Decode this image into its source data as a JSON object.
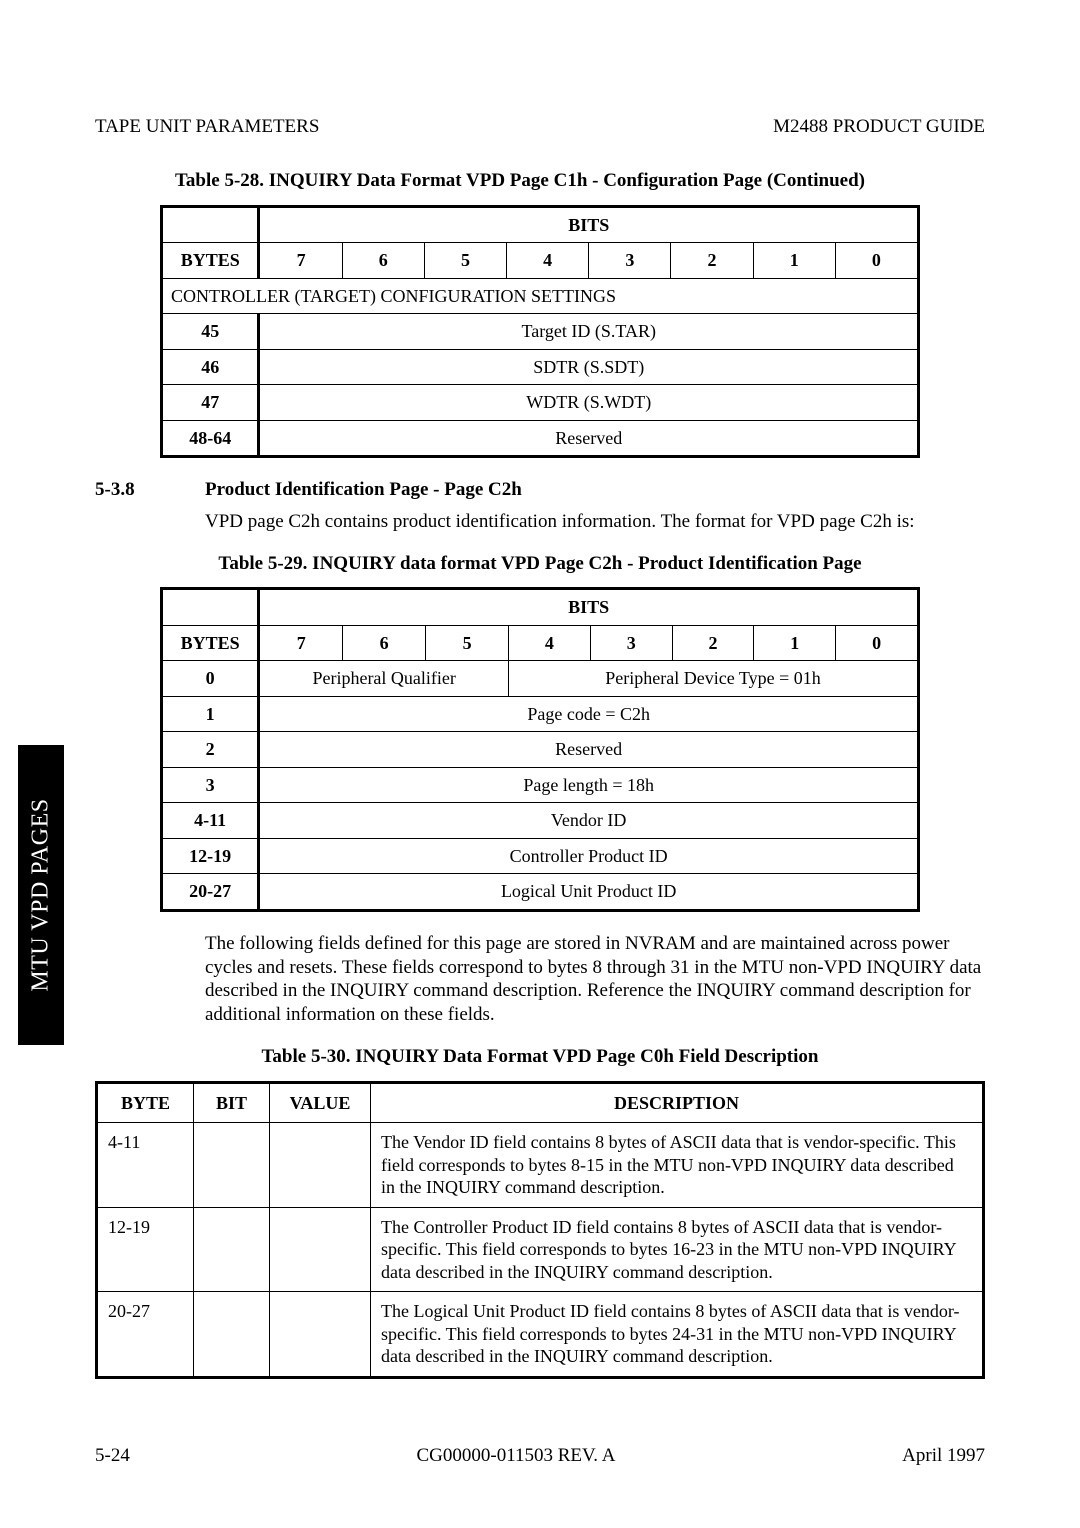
{
  "header": {
    "left": "TAPE UNIT PARAMETERS",
    "right": "M2488 PRODUCT GUIDE"
  },
  "side_tab": "MTU VPD PAGES",
  "table28": {
    "caption": "Table 5-28.   INQUIRY Data Format VPD Page C1h - Configuration Page  (Continued)",
    "bits_label": "BITS",
    "bytes_label": "BYTES",
    "bits": [
      "7",
      "6",
      "5",
      "4",
      "3",
      "2",
      "1",
      "0"
    ],
    "section": "CONTROLLER (TARGET) CONFIGURATION SETTINGS",
    "rows": [
      {
        "byte": "45",
        "desc": "Target ID (S.TAR)"
      },
      {
        "byte": "46",
        "desc": "SDTR (S.SDT)"
      },
      {
        "byte": "47",
        "desc": "WDTR (S.WDT)"
      },
      {
        "byte": "48-64",
        "desc": "Reserved"
      }
    ]
  },
  "section538": {
    "num": "5-3.8",
    "title": "Product Identification Page - Page C2h",
    "para": "VPD page C2h contains product identification information. The format for VPD page C2h is:"
  },
  "table29": {
    "caption": "Table 5-29.   INQUIRY data format VPD Page C2h - Product Identification Page",
    "bits_label": "BITS",
    "bytes_label": "BYTES",
    "bits": [
      "7",
      "6",
      "5",
      "4",
      "3",
      "2",
      "1",
      "0"
    ],
    "row0": {
      "byte": "0",
      "left": "Peripheral Qualifier",
      "right": "Peripheral Device Type = 01h"
    },
    "rows": [
      {
        "byte": "1",
        "desc": "Page code  = C2h"
      },
      {
        "byte": "2",
        "desc": "Reserved"
      },
      {
        "byte": "3",
        "desc": "Page length  = 18h"
      },
      {
        "byte": "4-11",
        "desc": "Vendor ID"
      },
      {
        "byte": "12-19",
        "desc": "Controller Product ID"
      },
      {
        "byte": "20-27",
        "desc": "Logical Unit Product ID"
      }
    ]
  },
  "para_after_t29": "The following fields defined for this page are stored in NVRAM and are maintained across power cycles and resets. These fields correspond to bytes 8 through 31 in the MTU non-VPD INQUIRY data described in the INQUIRY command description. Reference the INQUIRY command description for additional information on these fields.",
  "table30": {
    "caption": "Table 5-30.   INQUIRY Data Format VPD Page C0h Field Description",
    "headers": {
      "byte": "BYTE",
      "bit": "BIT",
      "value": "VALUE",
      "desc": "DESCRIPTION"
    },
    "rows": [
      {
        "byte": "4-11",
        "bit": "",
        "value": "",
        "desc": "The Vendor ID field contains 8 bytes of ASCII data that is vendor-specific.  This field corresponds to bytes 8-15 in the MTU non-VPD INQUIRY data described in the INQUIRY command description."
      },
      {
        "byte": "12-19",
        "bit": "",
        "value": "",
        "desc": "The Controller Product ID field contains 8 bytes of ASCII data that is vendor-specific. This field corresponds to bytes 16-23 in the MTU non-VPD INQUIRY data described in the INQUIRY command description."
      },
      {
        "byte": "20-27",
        "bit": "",
        "value": "",
        "desc": "The Logical Unit Product ID field contains 8 bytes of ASCII data that is vendor-specific.  This field corresponds to bytes 24-31 in the MTU non-VPD INQUIRY data described in the INQUIRY command description."
      }
    ]
  },
  "footer": {
    "left": "5-24",
    "center": "CG00000-011503 REV. A",
    "right": "April 1997"
  }
}
